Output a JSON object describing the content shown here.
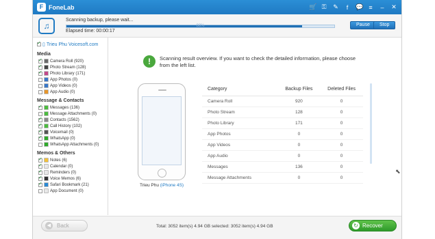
{
  "app": {
    "title": "FoneLab"
  },
  "toolbar": {
    "icons": [
      "cart-icon",
      "key-icon",
      "wrench-icon",
      "facebook-icon",
      "chat-icon",
      "menu-icon",
      "minimize-icon",
      "close-icon"
    ]
  },
  "scan": {
    "status": "Scanning backup, please wait...",
    "elapsed_label": "Elapsed time: 00:00:17",
    "percent_text": "88%",
    "progress": 0.88,
    "pause_label": "Pause",
    "stop_label": "Stop"
  },
  "sidebar": {
    "device": "Trieu Phu Voicesoft.com",
    "groups": [
      {
        "name": "Media",
        "items": [
          {
            "label": "Camera Roll (920)",
            "checked": true,
            "color": "#6b6b6b"
          },
          {
            "label": "Photo Stream (128)",
            "checked": true,
            "color": "#444444"
          },
          {
            "label": "Photo Library (171)",
            "checked": true,
            "color": "#c44a8a"
          },
          {
            "label": "App Photos (0)",
            "checked": false,
            "color": "#3a78c8"
          },
          {
            "label": "App Videos (0)",
            "checked": false,
            "color": "#3a78c8"
          },
          {
            "label": "App Audio (0)",
            "checked": false,
            "color": "#e8962a"
          }
        ]
      },
      {
        "name": "Message & Contacts",
        "items": [
          {
            "label": "Messages (136)",
            "checked": true,
            "color": "#4cbc3f"
          },
          {
            "label": "Message Attachments (0)",
            "checked": false,
            "color": "#4cbc3f"
          },
          {
            "label": "Contacts (1562)",
            "checked": true,
            "color": "#8a8a8a"
          },
          {
            "label": "Call History (102)",
            "checked": true,
            "color": "#4cbc3f"
          },
          {
            "label": "Voicemail (0)",
            "checked": true,
            "color": "#555555"
          },
          {
            "label": "WhatsApp (0)",
            "checked": true,
            "color": "#2faa2a"
          },
          {
            "label": "WhatsApp Attachments (0)",
            "checked": false,
            "color": "#2faa2a"
          }
        ]
      },
      {
        "name": "Memos & Others",
        "items": [
          {
            "label": "Notes (6)",
            "checked": true,
            "color": "#f2c23a"
          },
          {
            "label": "Calendar (0)",
            "checked": true,
            "color": "#e8e8e8"
          },
          {
            "label": "Reminders (0)",
            "checked": true,
            "color": "#e8e8e8"
          },
          {
            "label": "Voice Memos (6)",
            "checked": true,
            "color": "#333333"
          },
          {
            "label": "Safari Bookmark (21)",
            "checked": true,
            "color": "#2b8ad6"
          },
          {
            "label": "App Document (0)",
            "checked": false,
            "color": "#e8e8e8"
          }
        ]
      }
    ]
  },
  "notice": {
    "text": "Scanning result overview. If you want to check the detailed information, please choose from the left list."
  },
  "device_preview": {
    "name": "Trieu Phu",
    "model": "(iPhone 4S)"
  },
  "results": {
    "headers": [
      "Category",
      "Backup Files",
      "Deleted Files"
    ],
    "rows": [
      [
        "Camera Roll",
        "920",
        "0"
      ],
      [
        "Photo Stream",
        "128",
        "0"
      ],
      [
        "Photo Library",
        "171",
        "0"
      ],
      [
        "App Photos",
        "0",
        "0"
      ],
      [
        "App Videos",
        "0",
        "0"
      ],
      [
        "App Audio",
        "0",
        "0"
      ],
      [
        "Messages",
        "136",
        "0"
      ],
      [
        "Message Attachments",
        "0",
        "0"
      ]
    ]
  },
  "footer": {
    "back_label": "Back",
    "totals": "Total: 3052 item(s) 4.94 GB   selected: 3052 item(s) 4.94 GB",
    "recover_label": "Recover"
  }
}
